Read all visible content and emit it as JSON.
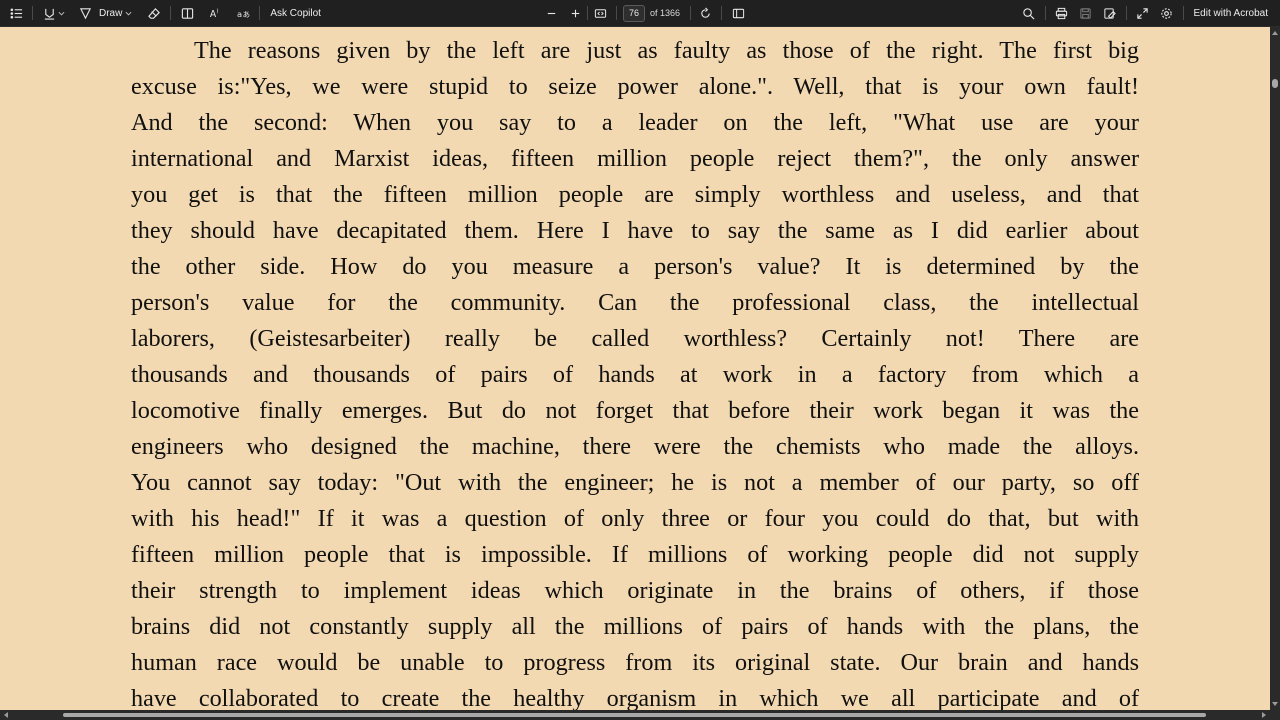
{
  "toolbar": {
    "draw_label": "Draw",
    "ask_copilot_label": "Ask Copilot",
    "page_current": "76",
    "page_total": "of 1366",
    "edit_acrobat_label": "Edit with Acrobat",
    "icons": [
      "contents-icon",
      "highlight-icon",
      "draw-icon",
      "erase-icon",
      "text-box-icon",
      "read-aloud-icon",
      "translate-icon",
      "zoom-out-icon",
      "zoom-in-icon",
      "fit-page-icon",
      "rotate-icon",
      "page-view-icon",
      "search-icon",
      "print-icon",
      "save-icon",
      "save-as-icon",
      "fullscreen-icon",
      "settings-icon"
    ]
  },
  "document": {
    "lines": [
      "The reasons given by the left are just as faulty as those of the right. The first big",
      "excuse is:\"Yes, we were stupid to seize power alone.\". Well, that is your own fault!",
      "And the second: When you say to a leader on the left, \"What use are your",
      "international and Marxist ideas, fifteen million people reject them?\", the only answer",
      "you get is that the fifteen million people are simply worthless and useless, and that",
      "they should have decapitated them. Here I have to say the same as I did earlier about",
      "the other side. How do you measure a person's value? It is determined by the",
      "person's value for the community. Can the professional class, the intellectual",
      "laborers, (Geistesarbeiter) really be called worthless? Certainly not! There are",
      "thousands and thousands of pairs of hands at work in a factory from which a",
      "locomotive finally emerges. But do not forget that before their work began it was the",
      "engineers who designed the machine, there were the chemists who made the alloys.",
      "You cannot say today: \"Out with the engineer; he is not a member of our party, so off",
      "with his head!\" If it was a question of only three or four you could do that, but with",
      "fifteen million people that is impossible. If millions of working people did not supply",
      "their strength to implement ideas which originate in the brains of others, if those",
      "brains did not constantly supply all the millions of pairs of hands with the plans, the",
      "human race would be unable to progress from its original state. Our brain and hands",
      "have collaborated to create the healthy organism in which we all participate and of"
    ]
  },
  "colors": {
    "toolbar_bg": "#202020",
    "page_bg": "#f3d9b1",
    "text": "#111111"
  }
}
